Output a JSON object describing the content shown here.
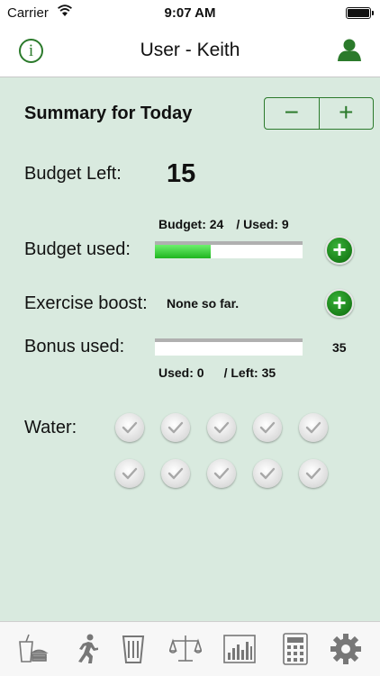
{
  "status_bar": {
    "carrier": "Carrier",
    "time": "9:07 AM",
    "wifi_icon": "wifi-icon",
    "battery_icon": "battery-icon"
  },
  "nav": {
    "title": "User - Keith",
    "info_icon": "info-icon",
    "info_glyph": "i",
    "user_icon": "user-icon"
  },
  "summary": {
    "title": "Summary for Today",
    "decrement": "−",
    "increment": "+"
  },
  "budget": {
    "left_label": "Budget Left:",
    "left_value": "15",
    "total_text": "Budget: 24",
    "used_text": "/ Used: 9",
    "used_label": "Budget used:",
    "used_fraction": 0.375
  },
  "exercise": {
    "label": "Exercise boost:",
    "value": "None so far."
  },
  "bonus": {
    "label": "Bonus used:",
    "value": "35",
    "used_text": "Used: 0",
    "left_text": "/ Left: 35",
    "used_fraction": 0
  },
  "add_glyph": "+",
  "water": {
    "label": "Water:",
    "cups": 10,
    "cup_icon": "checkmark-icon"
  },
  "colors": {
    "accent": "#2b7a2b",
    "background": "#d9eadf",
    "bar_fill": "#2ecc2e"
  },
  "tabs": [
    {
      "name": "food",
      "icon": "food-drink-icon"
    },
    {
      "name": "exercise",
      "icon": "running-icon"
    },
    {
      "name": "water",
      "icon": "water-glass-icon"
    },
    {
      "name": "weight",
      "icon": "scale-icon"
    },
    {
      "name": "charts",
      "icon": "bar-chart-icon"
    },
    {
      "name": "calculator",
      "icon": "calculator-icon"
    },
    {
      "name": "settings",
      "icon": "gear-icon"
    }
  ]
}
